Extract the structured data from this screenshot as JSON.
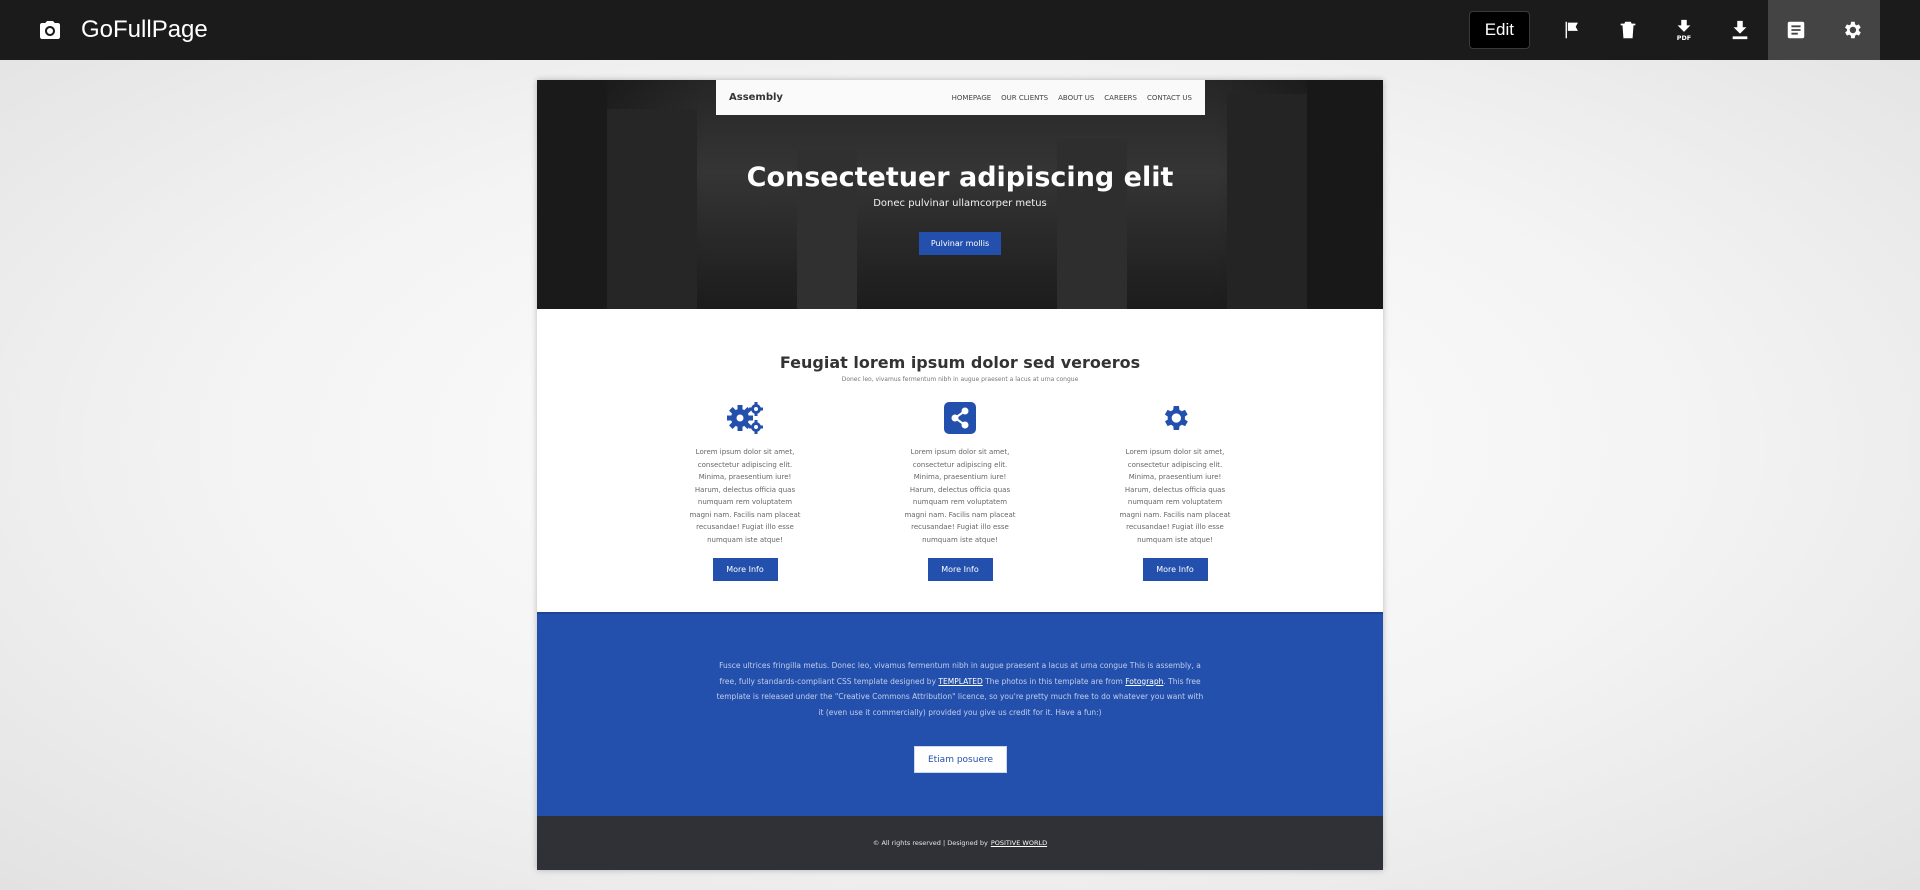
{
  "app": {
    "title": "GoFullPage",
    "edit_label": "Edit",
    "tools": [
      "flag-icon",
      "trash-icon",
      "download-pdf-icon",
      "download-icon",
      "notes-icon",
      "gear-icon"
    ]
  },
  "site": {
    "nav": {
      "logo": "Assembly",
      "links": [
        "HOMEPAGE",
        "OUR CLIENTS",
        "ABOUT US",
        "CAREERS",
        "CONTACT US"
      ]
    },
    "hero": {
      "title": "Consectetuer adipiscing elit",
      "subtitle": "Donec pulvinar ullamcorper metus",
      "button": "Pulvinar mollis"
    },
    "features": {
      "title": "Feugiat lorem ipsum dolor sed veroeros",
      "subtitle": "Donec leo, vivamus fermentum nibh in augue praesent a lacus at urna congue",
      "items": [
        {
          "icon": "gears-icon",
          "text": "Lorem ipsum dolor sit amet, consectetur adipiscing elit. Minima, praesentium iure! Harum, delectus officia quas numquam rem voluptatem magni nam. Facilis nam placeat recusandae! Fugiat illo esse numquam iste atque!",
          "button": "More Info"
        },
        {
          "icon": "share-icon",
          "text": "Lorem ipsum dolor sit amet, consectetur adipiscing elit. Minima, praesentium iure! Harum, delectus officia quas numquam rem voluptatem magni nam. Facilis nam placeat recusandae! Fugiat illo esse numquam iste atque!",
          "button": "More Info"
        },
        {
          "icon": "gear-icon",
          "text": "Lorem ipsum dolor sit amet, consectetur adipiscing elit. Minima, praesentium iure! Harum, delectus officia quas numquam rem voluptatem magni nam. Facilis nam placeat recusandae! Fugiat illo esse numquam iste atque!",
          "button": "More Info"
        }
      ]
    },
    "band": {
      "text_before": "Fusce ultrices fringilla metus. Donec leo, vivamus fermentum nibh in augue praesent a lacus at urna congue This is assembly, a free, fully standards-compliant CSS template designed by",
      "link1": "TEMPLATED",
      "text_middle": "The photos in this template are from",
      "link2": "Fotograph",
      "text_after": ". This free template is released under the \"Creative Commons Attribution\" licence, so you're pretty much free to do whatever you want with it (even use it commercially) provided you give us credit for it. Have a fun:)",
      "button": "Etiam posuere"
    },
    "footer": {
      "text": "© All rights reserved | Designed by",
      "link": "POSITIVE WORLD"
    }
  },
  "colors": {
    "topbar": "#1b1b1b",
    "accent_blue": "#2450ad",
    "footer_dark": "#2f3136"
  }
}
